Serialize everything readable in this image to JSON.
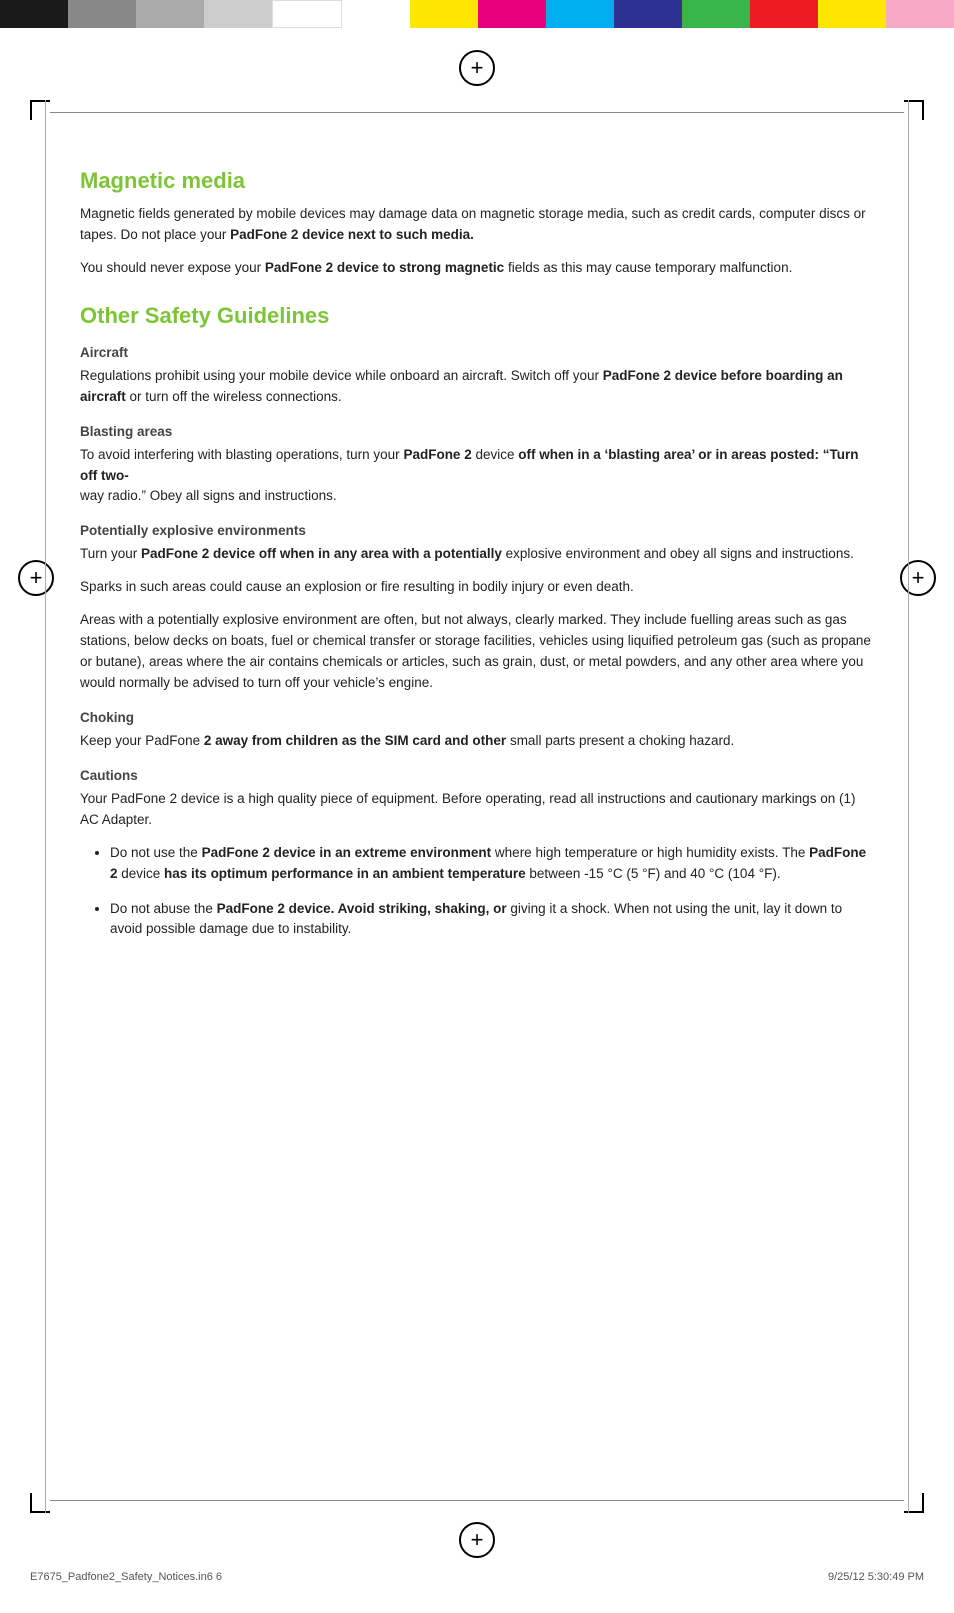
{
  "colorBar": {
    "segments": [
      {
        "class": "cb-black1",
        "flex": 2
      },
      {
        "class": "cb-gray1",
        "flex": 2
      },
      {
        "class": "cb-gray2",
        "flex": 2
      },
      {
        "class": "cb-gray3",
        "flex": 2
      },
      {
        "class": "cb-white",
        "flex": 2
      },
      {
        "class": "cb-yellow",
        "flex": 2
      },
      {
        "class": "cb-magenta",
        "flex": 2
      },
      {
        "class": "cb-cyan",
        "flex": 2
      },
      {
        "class": "cb-navy",
        "flex": 2
      },
      {
        "class": "cb-green2",
        "flex": 2
      },
      {
        "class": "cb-red",
        "flex": 2
      },
      {
        "class": "cb-yellow",
        "flex": 2
      },
      {
        "class": "cb-pink",
        "flex": 2
      }
    ]
  },
  "sections": {
    "magneticMedia": {
      "heading": "Magnetic media",
      "para1": "Magnetic fields generated by mobile devices may damage data on magnetic storage media, such as credit cards, computer discs or tapes. Do not place your ",
      "para1_bold": "PadFone 2 device next to such media.",
      "para2": "You should never expose your ",
      "para2_bold": "PadFone 2 device to strong magnetic",
      "para2_end": " fields as this may cause temporary malfunction."
    },
    "otherSafety": {
      "heading": "Other Safety Guidelines",
      "aircraft": {
        "subheading": "Aircraft",
        "para": "Regulations prohibit using your mobile device while onboard an aircraft. Switch off your ",
        "para_bold": "PadFone 2 device before boarding an aircraft",
        "para_end": " or turn off the wireless connections."
      },
      "blastingAreas": {
        "subheading": "Blasting areas",
        "para_start": "To avoid interfering with blasting operations, turn your ",
        "para_bold1": "PadFone 2",
        "para_mid": " device ",
        "para_bold2": "off when in a ‘blasting area’ or in areas posted: “Turn off two-",
        "para_end": "way radio.” Obey all signs and instructions."
      },
      "explosive": {
        "subheading": "Potentially explosive environments",
        "para1_start": "Turn your ",
        "para1_bold": "PadFone 2 device off when in any area with a potentially",
        "para1_end": " explosive environment and obey all signs and instructions.",
        "para2": "Sparks in such areas could cause an explosion or fire resulting in bodily injury or even death.",
        "para3": "Areas with a potentially explosive environment are often, but not always, clearly marked. They include fuelling areas such as gas stations, below decks on boats, fuel or chemical transfer or storage facilities, vehicles using liquified petroleum gas (such as propane or butane), areas where the air contains chemicals or articles, such as grain, dust, or metal powders, and any other area where you would normally be advised to turn off your vehicle’s engine."
      },
      "choking": {
        "subheading": "Choking",
        "para_start": "Keep your PadFone ",
        "para_bold": "2 away from children as the SIM card and other",
        "para_end": " small parts present a choking hazard."
      },
      "cautions": {
        "subheading": "Cautions",
        "para1": "Your PadFone 2 device is a high quality piece of equipment. Before operating, read all instructions and cautionary markings on (1) AC Adapter.",
        "bullets": [
          {
            "start": "Do not use the ",
            "bold1": "PadFone 2 device in an extreme environment",
            "mid": " where high temperature or high humidity exists. The ",
            "bold2": "PadFone 2",
            "mid2": " device ",
            "bold3": "has its optimum performance in an ambient temperature",
            "end": " between -15 °C (5 °F) and 40 °C (104 °F)."
          },
          {
            "start": "Do not abuse the ",
            "bold1": "PadFone 2 device. Avoid striking, shaking, or",
            "end": " giving it a shock. When not using the unit, lay it down to avoid possible damage due to instability."
          }
        ]
      }
    }
  },
  "footer": {
    "left": "E7675_Padfone2_Safety_Notices.in6   6",
    "right": "9/25/12   5:30:49 PM"
  }
}
